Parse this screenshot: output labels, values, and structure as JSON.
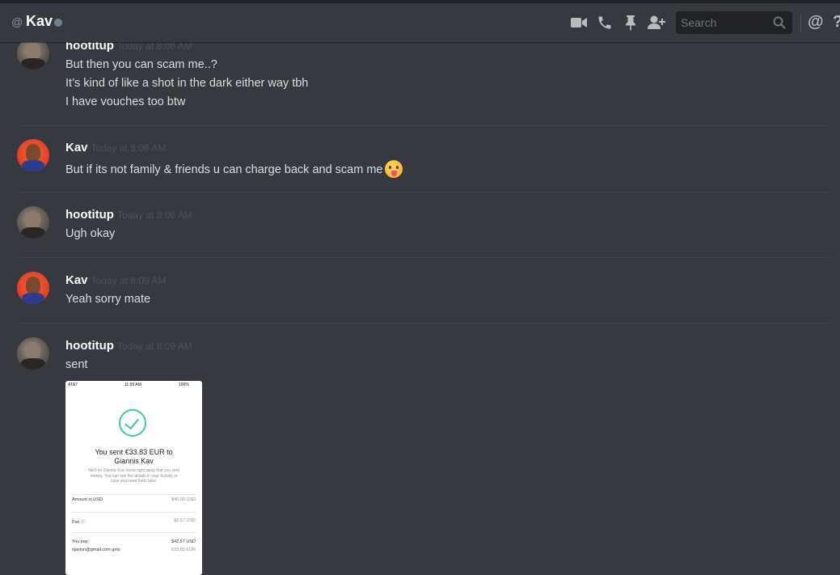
{
  "header": {
    "at_symbol": "@",
    "channel_name": "Kav",
    "search_placeholder": "Search",
    "mention_glyph": "@",
    "help_glyph": "?"
  },
  "icons": [
    "video-call-icon",
    "voice-call-icon",
    "pin-icon",
    "add-friend-icon",
    "search-icon",
    "mention-icon",
    "help-icon"
  ],
  "colors": {
    "background": "#36393f",
    "text": "#dcddde",
    "timestamp": "#4d5159",
    "accent_check": "#3fc6a8"
  },
  "messages": [
    {
      "author": "hootitup",
      "timestamp": "Today at 8:06 AM",
      "lines": [
        "But then you can scam me..?",
        "It’s kind of like a shot in the dark either way tbh",
        "I have vouches too btw"
      ]
    },
    {
      "author": "Kav",
      "timestamp": "Today at 8:06 AM",
      "lines": [
        "But if its not family & friends u can charge back and scam me"
      ],
      "emoji": "stuck-out-tongue-emoji"
    },
    {
      "author": "hootitup",
      "timestamp": "Today at 8:06 AM",
      "lines": [
        "Ugh okay"
      ]
    },
    {
      "author": "Kav",
      "timestamp": "Today at 8:09 AM",
      "lines": [
        "Yeah sorry mate"
      ]
    },
    {
      "author": "hootitup",
      "timestamp": "Today at 8:09 AM",
      "lines": [
        "sent"
      ]
    }
  ],
  "attachment": {
    "carrier": "AT&T",
    "time": "11:09 AM",
    "battery": "100%",
    "title_line1": "You sent €33.83 EUR to",
    "title_line2": "Giannis Kav",
    "desc_line1": "We'll let Giannis Kav know right away that you sent",
    "desc_line2": "money. You can see the details in your Activity in",
    "desc_line3": "case you need them later.",
    "rows": [
      {
        "label": "Amount in USD",
        "value": "$40.00 USD"
      },
      {
        "label": "Fee ⓘ",
        "value": "$2.57 USD"
      },
      {
        "label": "You pay",
        "value": "$42.57 USD"
      },
      {
        "label": "xjavinn@gmail.com gets",
        "value": "€33.83 EUR"
      }
    ]
  }
}
